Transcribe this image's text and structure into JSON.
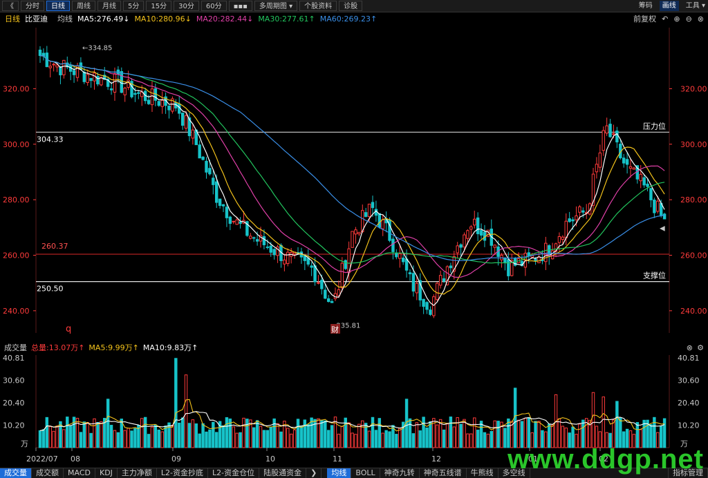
{
  "toolbar": {
    "back": "《",
    "periods": [
      "分时",
      "日线",
      "周线",
      "月线",
      "5分",
      "15分",
      "30分",
      "60分",
      "▪▪▪",
      "多周期图 ▾",
      "个股资料",
      "诊股"
    ],
    "active_period": "日线",
    "right": [
      "筹码",
      "画线",
      "工具 ▾"
    ]
  },
  "ma_row": {
    "period": "日线",
    "name": "比亚迪",
    "avg": "均线",
    "ma5": "MA5:276.49↓",
    "ma10": "MA10:280.96↓",
    "ma20": "MA20:282.44↓",
    "ma30": "MA30:277.61↑",
    "ma60": "MA60:269.23↑",
    "adjust": "前复权"
  },
  "colors": {
    "up": "#ff3b3b",
    "down": "#17c3c9",
    "ma5": "#ffffff",
    "ma10": "#f3c21b",
    "ma20": "#e040a8",
    "ma30": "#22c55e",
    "ma60": "#3a8fe8",
    "axis": "#ff3b3b",
    "bg": "#000000"
  },
  "price_chart": {
    "ylim": [
      232,
      342
    ],
    "yticks": [
      240,
      260,
      280,
      300,
      320
    ],
    "ytick_labels": [
      "240.00",
      "260.00",
      "280.00",
      "300.00",
      "320.00"
    ],
    "resistance": {
      "value": 304.33,
      "label": "304.33",
      "text": "压力位"
    },
    "support": {
      "value": 250.5,
      "label": "250.50",
      "text": "支撑位"
    },
    "reference": {
      "value": 260.37,
      "label": "260.37"
    },
    "high_note": "334.85",
    "low_note": "235.81",
    "marker_q": "q",
    "marker_cai": "财"
  },
  "volume_chart": {
    "label": "成交量",
    "total": "总量:13.07万↑",
    "ma5": "MA5:9.99万↑",
    "ma10": "MA10:9.83万↑",
    "ylim": [
      0,
      42
    ],
    "yticks": [
      10.2,
      20.4,
      30.6,
      40.81
    ],
    "ytick_labels": [
      "10.20",
      "20.40",
      "30.60",
      "40.81"
    ],
    "unit": "万"
  },
  "x_axis": {
    "labels": [
      "2022/07",
      "08",
      "09",
      "10",
      "11",
      "12",
      "01",
      "02"
    ]
  },
  "bottom_tabs": [
    "成交量",
    "成交额",
    "MACD",
    "KDJ",
    "主力净额",
    "L2-资金抄底",
    "L2-资金仓位",
    "陆股通资金",
    "均线",
    "BOLL",
    "神奇九转",
    "神奇五线谱",
    "牛熊线",
    "多空线",
    "指标管理"
  ],
  "bottom_active": [
    "成交量",
    "均线"
  ],
  "watermark": "www.ddgp.net",
  "chart_data": {
    "type": "candlestick",
    "title": "比亚迪 日线",
    "x_ticks": [
      "2022/07",
      "08",
      "09",
      "10",
      "11",
      "12",
      "01",
      "02"
    ],
    "ohlc_close_points": [
      {
        "x": "2022/07",
        "close": 332
      },
      {
        "x": "07",
        "close": 328
      },
      {
        "x": "07",
        "close": 326
      },
      {
        "x": "07",
        "close": 324
      },
      {
        "x": "08",
        "close": 322
      },
      {
        "x": "08",
        "close": 318
      },
      {
        "x": "08",
        "close": 316
      },
      {
        "x": "08",
        "close": 314
      },
      {
        "x": "09",
        "close": 300
      },
      {
        "x": "09",
        "close": 282
      },
      {
        "x": "09",
        "close": 272
      },
      {
        "x": "09",
        "close": 266
      },
      {
        "x": "10",
        "close": 262
      },
      {
        "x": "10",
        "close": 258
      },
      {
        "x": "10",
        "close": 255
      },
      {
        "x": "11",
        "close": 241
      },
      {
        "x": "11",
        "close": 268
      },
      {
        "x": "11",
        "close": 277
      },
      {
        "x": "11",
        "close": 266
      },
      {
        "x": "12",
        "close": 250
      },
      {
        "x": "12",
        "close": 242
      },
      {
        "x": "12",
        "close": 258
      },
      {
        "x": "12",
        "close": 272
      },
      {
        "x": "12",
        "close": 268
      },
      {
        "x": "01",
        "close": 256
      },
      {
        "x": "01",
        "close": 258
      },
      {
        "x": "01",
        "close": 262
      },
      {
        "x": "01",
        "close": 272
      },
      {
        "x": "02",
        "close": 276
      },
      {
        "x": "02",
        "close": 306
      },
      {
        "x": "02",
        "close": 292
      },
      {
        "x": "02",
        "close": 284
      },
      {
        "x": "02",
        "close": 272
      }
    ],
    "series": [
      {
        "name": "MA5",
        "last": 276.49
      },
      {
        "name": "MA10",
        "last": 280.96
      },
      {
        "name": "MA20",
        "last": 282.44
      },
      {
        "name": "MA30",
        "last": 277.61
      },
      {
        "name": "MA60",
        "last": 269.23
      }
    ],
    "volume": {
      "unit": "万",
      "total": 13.07,
      "ma5": 9.99,
      "ma10": 9.83,
      "max": 40.81
    }
  }
}
